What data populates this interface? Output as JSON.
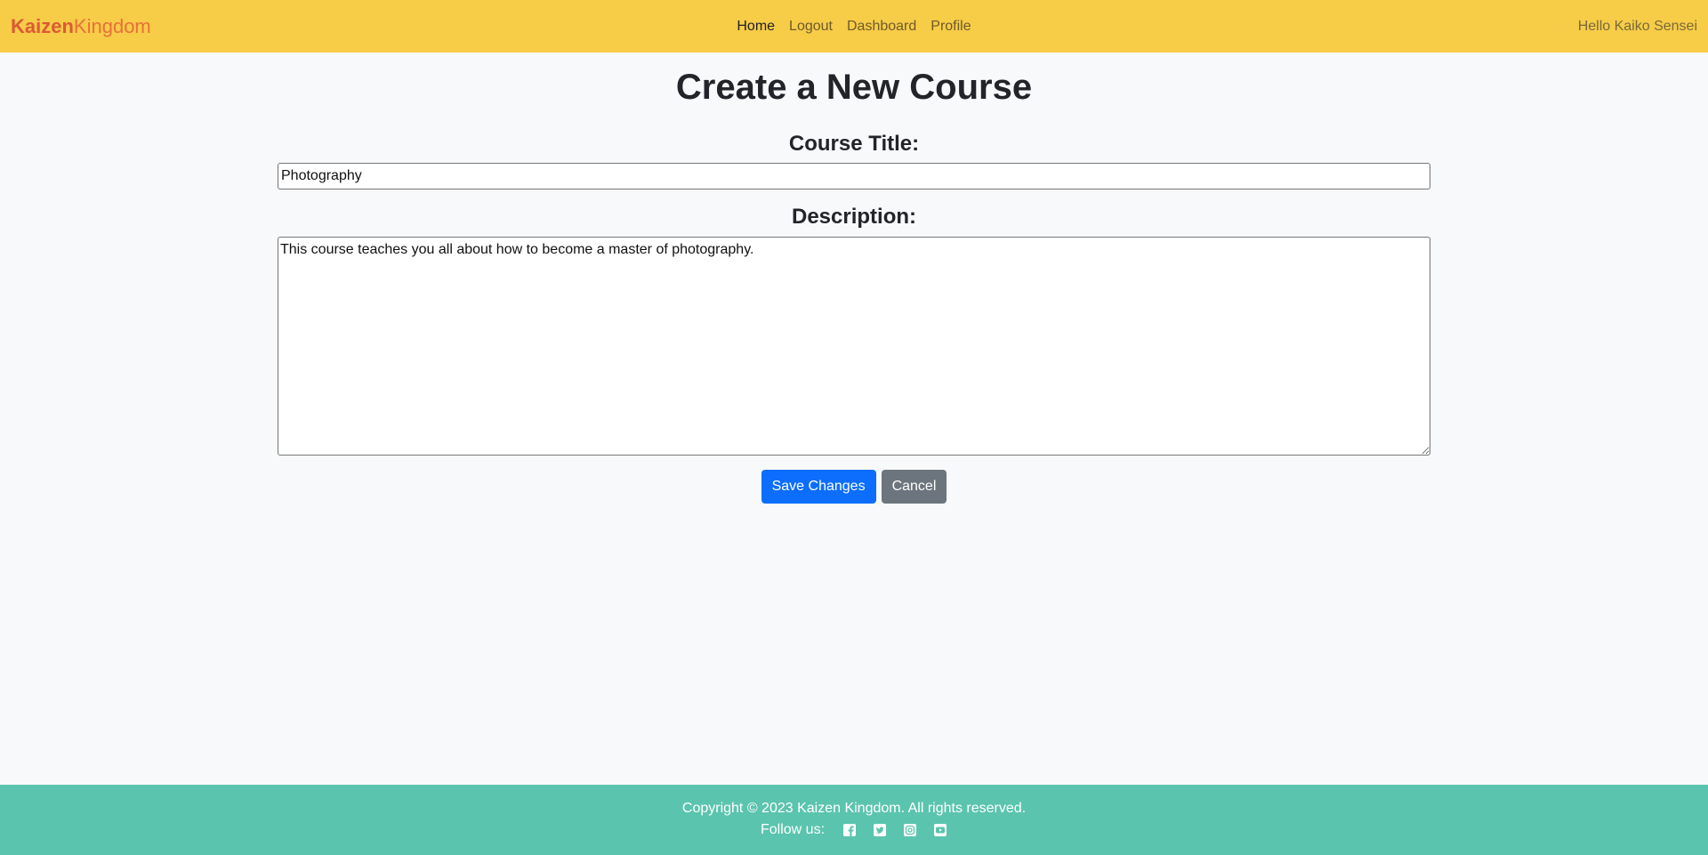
{
  "navbar": {
    "brand_bold": "Kaizen",
    "brand_light": "Kingdom",
    "links": [
      "Home",
      "Logout",
      "Dashboard",
      "Profile"
    ],
    "greeting": "Hello Kaiko Sensei"
  },
  "main": {
    "title": "Create a New Course",
    "course_title_label": "Course Title:",
    "course_title_value": "Photography",
    "description_label": "Description:",
    "description_value": "This course teaches you all about how to become a master of photography.",
    "save_label": "Save Changes",
    "cancel_label": "Cancel"
  },
  "footer": {
    "copyright": "Copyright © 2023 Kaizen Kingdom. All rights reserved.",
    "follow_label": "Follow us:",
    "social_icons": [
      "facebook-icon",
      "twitter-icon",
      "instagram-icon",
      "youtube-icon"
    ]
  },
  "colors": {
    "navbar_bg": "#f7cc47",
    "brand": "#dc5a34",
    "footer_bg": "#5bc4ae",
    "primary": "#0d6efd",
    "secondary": "#6c757d"
  }
}
